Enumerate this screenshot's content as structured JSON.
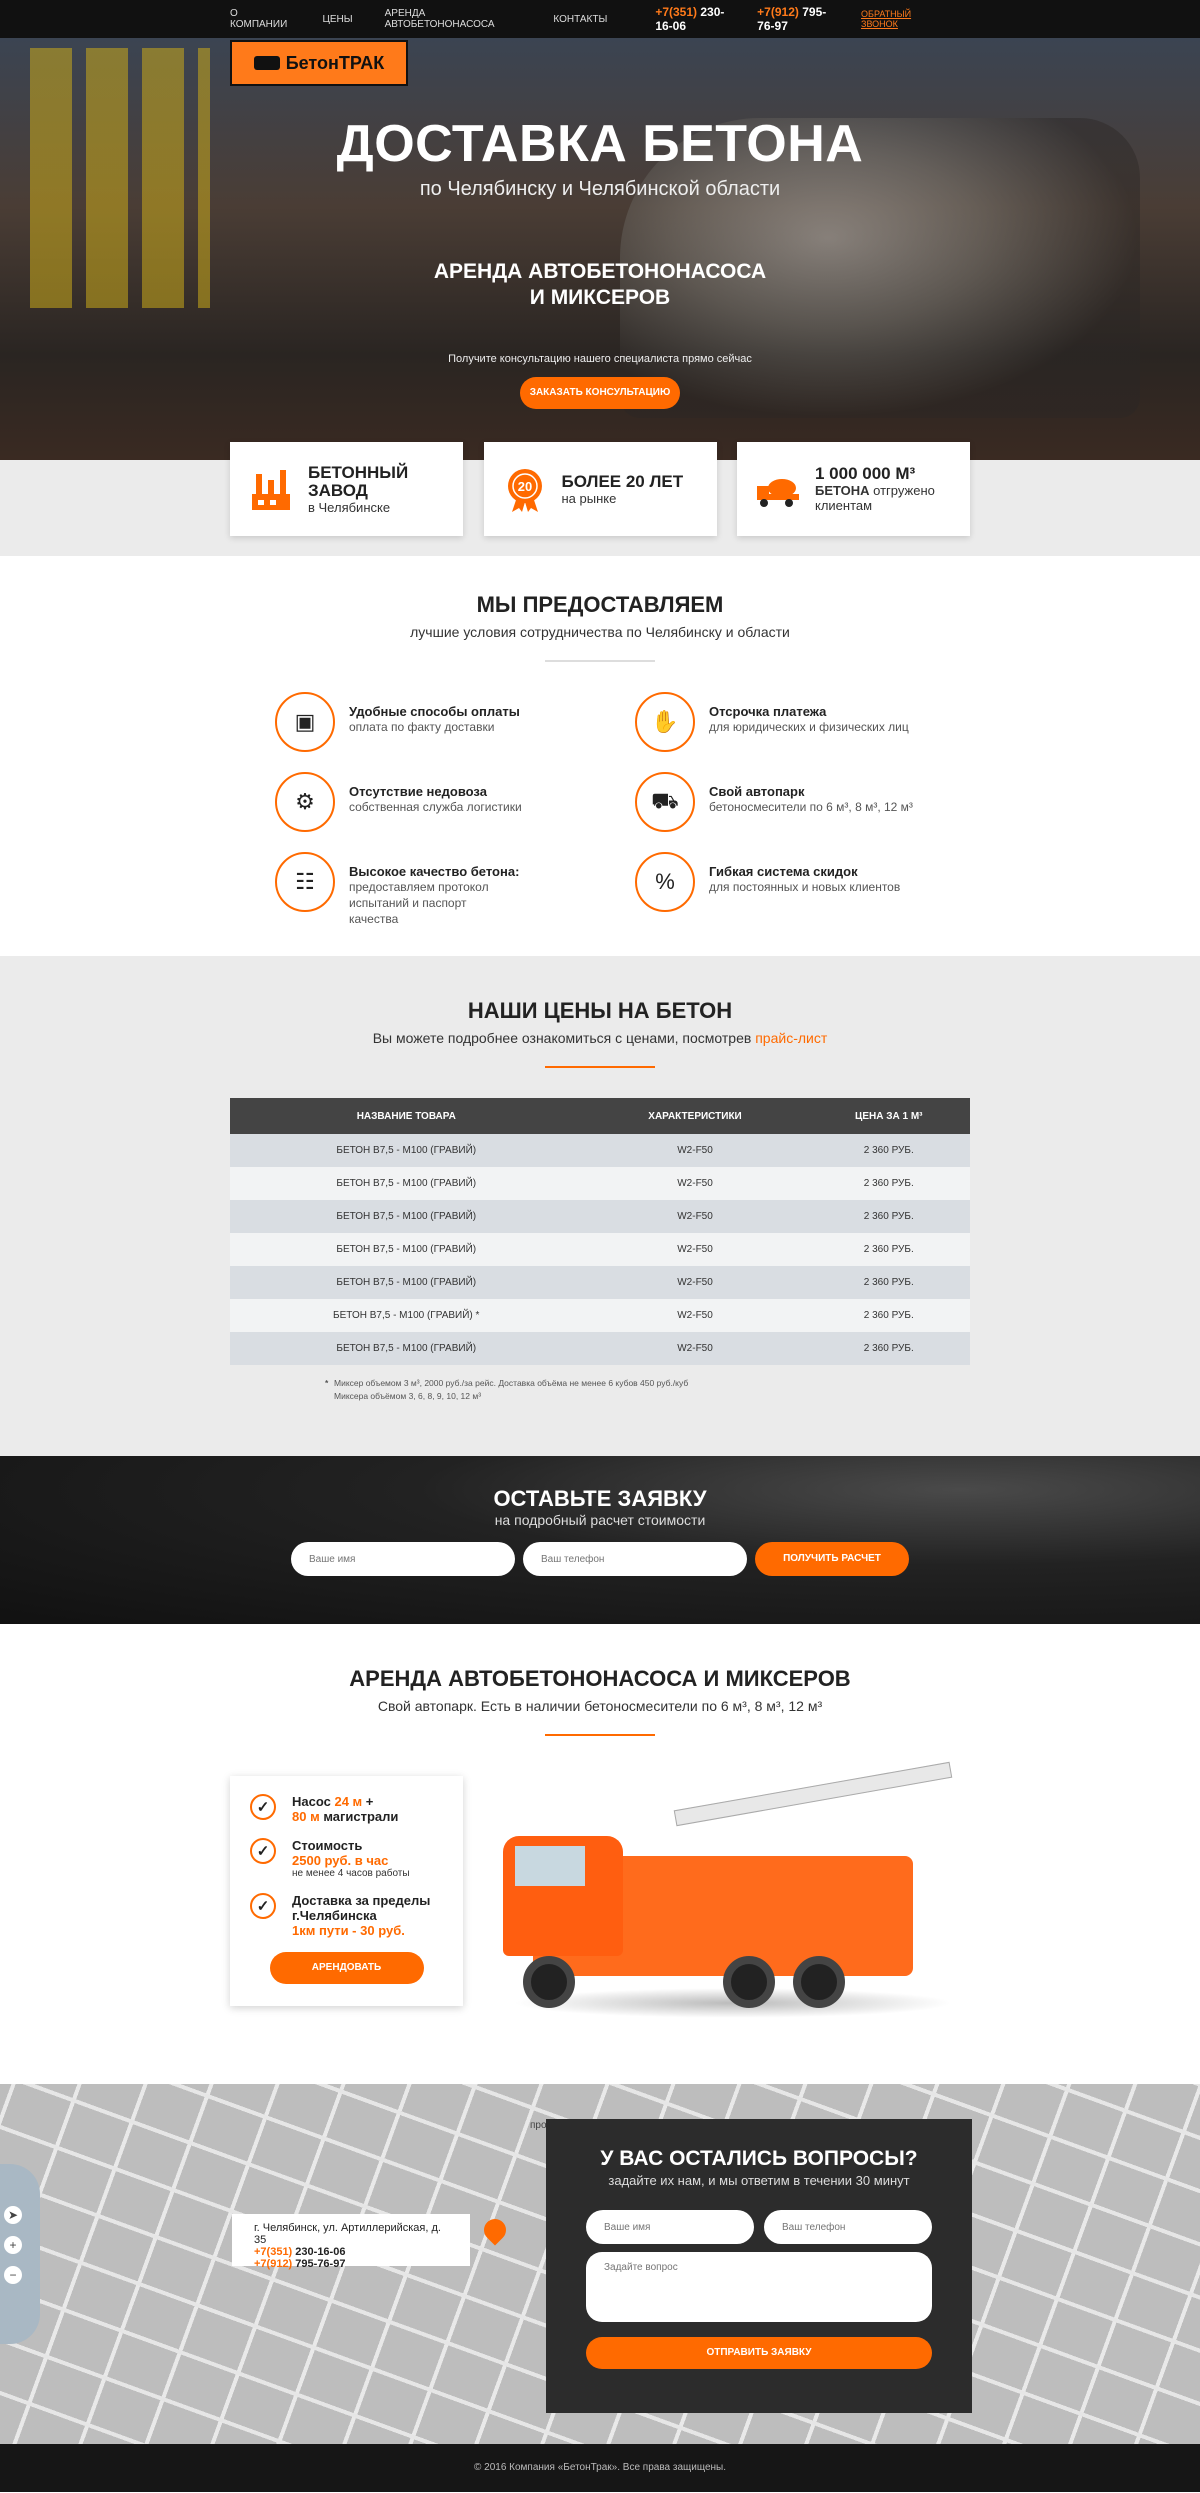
{
  "nav": {
    "items": [
      "О компании",
      "Цены",
      "Аренда автобетононасоса",
      "Контакты"
    ],
    "phone1_code": "+7(351)",
    "phone1_num": "230-16-06",
    "phone2_code": "+7(912)",
    "phone2_num": "795-76-97",
    "callback": "Обратный звонок"
  },
  "logo": "БетонТРАК",
  "hero": {
    "title": "ДОСТАВКА БЕТОНА",
    "subtitle": "по Челябинску и Челябинской области",
    "heading_l1": "АРЕНДА АВТОБЕТОНОНАСОСА",
    "heading_l2": "И МИКСЕРОВ",
    "consult": "Получите консультацию нашего специалиста прямо сейчас",
    "button": "Заказать консультацию"
  },
  "features": [
    {
      "t1": "БЕТОННЫЙ",
      "t1b": "ЗАВОД",
      "t2": "в Челябинске",
      "icon": "factory-icon"
    },
    {
      "t1": "БОЛЕЕ 20 ЛЕТ",
      "t1b": "",
      "t2": "на рынке",
      "icon": "badge-20-icon",
      "badge": "20"
    },
    {
      "t1": "1 000 000 м³",
      "t1b": "",
      "t2a": "БЕТОНА",
      "t2": "отгружено клиентам",
      "icon": "mixer-truck-icon"
    }
  ],
  "provide": {
    "title": "МЫ ПРЕДОСТАВЛЯЕМ",
    "subtitle": "лучшие условия сотрудничества по Челябинску и области",
    "items": [
      {
        "title": "Удобные способы оплаты",
        "desc": "оплата по факту доставки",
        "icon": "wallet-icon"
      },
      {
        "title": "Отсрочка платежа",
        "desc": "для юридических и физических лиц",
        "icon": "hand-money-icon"
      },
      {
        "title": "Отсутствие недовоза",
        "desc": "собственная служба логистики",
        "icon": "globe-gear-icon"
      },
      {
        "title": "Свой автопарк",
        "desc": "бетоносмесители по 6 м³, 8 м³, 12 м³",
        "icon": "truck-icon"
      },
      {
        "title": "Высокое качество бетона:",
        "desc": "предоставляем протокол испытаний и паспорт качества",
        "icon": "clipboard-icon"
      },
      {
        "title": "Гибкая система скидок",
        "desc": "для постоянных и новых клиентов",
        "icon": "percent-icon"
      }
    ]
  },
  "prices": {
    "title": "НАШИ ЦЕНЫ НА БЕТОН",
    "subtitle": "Вы можете подробнее ознакомиться с ценами, посмотрев",
    "link": "прайс-лист",
    "headers": [
      "Название товара",
      "Характеристики",
      "Цена за 1 м³"
    ],
    "rows": [
      [
        "Бетон В7,5 - М100 (гравий)",
        "W2-F50",
        "2 360 руб."
      ],
      [
        "Бетон В7,5 - М100 (гравий)",
        "W2-F50",
        "2 360 руб."
      ],
      [
        "Бетон В7,5 - М100 (гравий)",
        "W2-F50",
        "2 360 руб."
      ],
      [
        "Бетон В7,5 - М100 (гравий)",
        "W2-F50",
        "2 360 руб."
      ],
      [
        "Бетон В7,5 - М100 (гравий)",
        "W2-F50",
        "2 360 руб."
      ],
      [
        "Бетон В7,5 - М100 (гравий) *",
        "W2-F50",
        "2 360 руб."
      ],
      [
        "Бетон В7,5 - М100 (гравий)",
        "W2-F50",
        "2 360 руб."
      ]
    ],
    "note_mark": "*",
    "note1": "Миксер объемом 3 м³, 2000 руб./за рейс. Доставка объёма не менее 6 кубов 450 руб./куб",
    "note2": "Миксера объёмом 3, 6, 8, 9, 10, 12 м³"
  },
  "request": {
    "title": "ОСТАВЬТЕ ЗАЯВКУ",
    "subtitle": "на подробный расчет стоимости",
    "name_ph": "Ваше имя",
    "phone_ph": "Ваш телефон",
    "button": "Получить расчет"
  },
  "rent": {
    "title": "АРЕНДА АВТОБЕТОНОНАСОСА И МИКСЕРОВ",
    "subtitle": "Свой автопарк. Есть в наличии бетоносмесители по 6 м³, 8 м³, 12 м³",
    "r1a": "Насос ",
    "r1b": "24 м",
    "r1c": " +",
    "r1d": "80 м",
    "r1e": " магистрали",
    "r2a": "Стоимость",
    "r2b": "2500 руб. в час",
    "r2c": "не менее 4 часов работы",
    "r3a": "Доставка за пределы г.Челябинска",
    "r3b": "1км пути - 30 руб.",
    "button": "Арендовать"
  },
  "contact": {
    "address": "г. Челябинск, ул. Артиллерийская, д. 35",
    "phone1_code": "+7(351)",
    "phone1_num": "230-16-06",
    "phone2_code": "+7(912)",
    "phone2_num": "795-76-97",
    "title": "У ВАС ОСТАЛИСЬ ВОПРОСЫ?",
    "subtitle": "задайте их нам, и мы ответим в течении 30 минут",
    "name_ph": "Ваше имя",
    "phone_ph": "Ваш телефон",
    "question_ph": "Задайте вопрос",
    "button": "Отправить заявку",
    "map_label": "просп. Победы"
  },
  "footer": "© 2016 Компания «БетонТрак». Все права защищены.",
  "colors": {
    "accent": "#ff6a00",
    "dark": "#2c2c2c"
  }
}
